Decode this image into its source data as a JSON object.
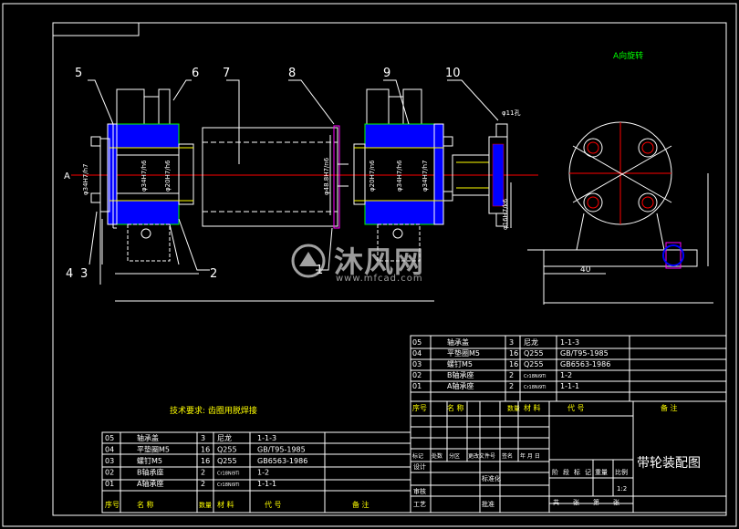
{
  "view_label": "A向旋转",
  "tech_requirement": "技术要求: 齿圈用脱焊接",
  "title_block_name": "带轮装配图",
  "part_numbers": [
    "5",
    "6",
    "7",
    "8",
    "9",
    "10",
    "4",
    "3",
    "1",
    "2"
  ],
  "dims": {
    "left_bearing_1": "φ34H7/h7",
    "left_bearing_2": "φ34H7/h6",
    "left_bearing_3": "φ20H7/h6",
    "drum": "φ48.8H7/n6",
    "right_bearing_1": "φ20H7/n6",
    "right_bearing_2": "φ34H7/h6",
    "right_bearing_3": "φ34H7/h7",
    "shaft_end": "φ16H7/k6",
    "hole_callout": "φ11孔",
    "base_width": "40",
    "section_marker": "A"
  },
  "bom_headers": {
    "no": "序号",
    "name": "名 称",
    "qty": "数量",
    "material": "材 料",
    "code": "代 号",
    "remark": "备 注"
  },
  "bom_rows": [
    {
      "no": "05",
      "name": "轴承盖",
      "qty": "3",
      "material": "尼龙",
      "code": "1-1-3"
    },
    {
      "no": "04",
      "name": "平垫圈M5",
      "qty": "16",
      "material": "Q255",
      "code": "GB/T95-1985"
    },
    {
      "no": "03",
      "name": "螺钉M5",
      "qty": "16",
      "material": "Q255",
      "code": "GB6563-1986"
    },
    {
      "no": "02",
      "name": "B轴承座",
      "qty": "2",
      "material": "Cr18Ni9Ti",
      "code": "1-2"
    },
    {
      "no": "01",
      "name": "A轴承座",
      "qty": "2",
      "material": "Cr18Ni9Ti",
      "code": "1-1-1"
    }
  ],
  "title_labels": {
    "revision": [
      "标记",
      "处数",
      "分区",
      "更改文件号",
      "签名",
      "年 月 日"
    ],
    "design": "设计",
    "standardize": "标准化",
    "check": "审核",
    "process": "工艺",
    "approve": "批准",
    "stage": [
      "阶",
      "段",
      "标",
      "记"
    ],
    "weight": "重量",
    "scale": "比例",
    "scale_value": "1:2",
    "sheets": [
      "共",
      "张",
      "第",
      "张"
    ]
  },
  "watermark": {
    "name": "沐风网",
    "url": "www.mfcad.com"
  },
  "colors": {
    "green": "#00ff00",
    "yellow": "#ffff00",
    "red": "#ff0000",
    "blue": "#0000ff",
    "cyan": "#00ffff",
    "magenta": "#ff00ff"
  }
}
